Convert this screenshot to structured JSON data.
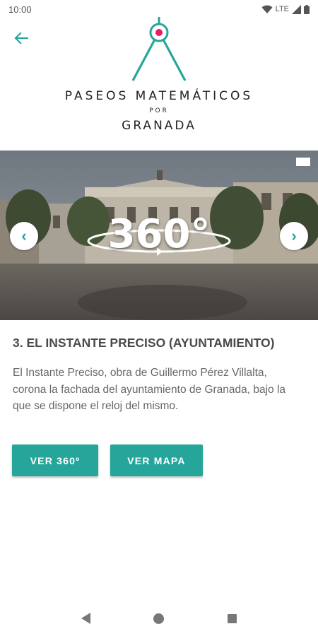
{
  "status": {
    "time": "10:00",
    "network": "LTE"
  },
  "logo": {
    "line1": "PASEOS MATEMÁTICOS",
    "line2": "POR",
    "line3": "GRANADA"
  },
  "hero": {
    "overlay_text": "360°"
  },
  "content": {
    "title": "3. EL INSTANTE PRECISO (AYUNTAMIENTO)",
    "description": "El Instante Preciso, obra de Guillermo Pérez Villalta, corona la fachada del ayuntamiento de Granada, bajo la que se dispone el reloj del mismo."
  },
  "buttons": {
    "view_360": "VER 360º",
    "view_map": "VER MAPA"
  },
  "colors": {
    "accent": "#26a69a",
    "logo_pin": "#e91e63"
  }
}
